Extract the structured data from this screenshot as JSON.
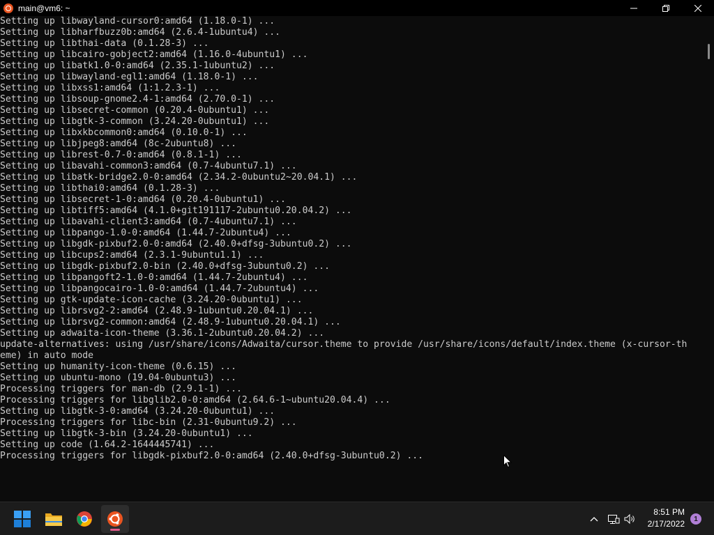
{
  "window": {
    "title": "main@vm6: ~"
  },
  "terminal": {
    "lines": [
      "Setting up libwayland-cursor0:amd64 (1.18.0-1) ...",
      "Setting up libharfbuzz0b:amd64 (2.6.4-1ubuntu4) ...",
      "Setting up libthai-data (0.1.28-3) ...",
      "Setting up libcairo-gobject2:amd64 (1.16.0-4ubuntu1) ...",
      "Setting up libatk1.0-0:amd64 (2.35.1-1ubuntu2) ...",
      "Setting up libwayland-egl1:amd64 (1.18.0-1) ...",
      "Setting up libxss1:amd64 (1:1.2.3-1) ...",
      "Setting up libsoup-gnome2.4-1:amd64 (2.70.0-1) ...",
      "Setting up libsecret-common (0.20.4-0ubuntu1) ...",
      "Setting up libgtk-3-common (3.24.20-0ubuntu1) ...",
      "Setting up libxkbcommon0:amd64 (0.10.0-1) ...",
      "Setting up libjpeg8:amd64 (8c-2ubuntu8) ...",
      "Setting up librest-0.7-0:amd64 (0.8.1-1) ...",
      "Setting up libavahi-common3:amd64 (0.7-4ubuntu7.1) ...",
      "Setting up libatk-bridge2.0-0:amd64 (2.34.2-0ubuntu2~20.04.1) ...",
      "Setting up libthai0:amd64 (0.1.28-3) ...",
      "Setting up libsecret-1-0:amd64 (0.20.4-0ubuntu1) ...",
      "Setting up libtiff5:amd64 (4.1.0+git191117-2ubuntu0.20.04.2) ...",
      "Setting up libavahi-client3:amd64 (0.7-4ubuntu7.1) ...",
      "Setting up libpango-1.0-0:amd64 (1.44.7-2ubuntu4) ...",
      "Setting up libgdk-pixbuf2.0-0:amd64 (2.40.0+dfsg-3ubuntu0.2) ...",
      "Setting up libcups2:amd64 (2.3.1-9ubuntu1.1) ...",
      "Setting up libgdk-pixbuf2.0-bin (2.40.0+dfsg-3ubuntu0.2) ...",
      "Setting up libpangoft2-1.0-0:amd64 (1.44.7-2ubuntu4) ...",
      "Setting up libpangocairo-1.0-0:amd64 (1.44.7-2ubuntu4) ...",
      "Setting up gtk-update-icon-cache (3.24.20-0ubuntu1) ...",
      "Setting up librsvg2-2:amd64 (2.48.9-1ubuntu0.20.04.1) ...",
      "Setting up librsvg2-common:amd64 (2.48.9-1ubuntu0.20.04.1) ...",
      "Setting up adwaita-icon-theme (3.36.1-2ubuntu0.20.04.2) ...",
      "update-alternatives: using /usr/share/icons/Adwaita/cursor.theme to provide /usr/share/icons/default/index.theme (x-cursor-th",
      "eme) in auto mode",
      "Setting up humanity-icon-theme (0.6.15) ...",
      "Setting up ubuntu-mono (19.04-0ubuntu3) ...",
      "Processing triggers for man-db (2.9.1-1) ...",
      "Processing triggers for libglib2.0-0:amd64 (2.64.6-1~ubuntu20.04.4) ...",
      "Setting up libgtk-3-0:amd64 (3.24.20-0ubuntu1) ...",
      "Processing triggers for libc-bin (2.31-0ubuntu9.2) ...",
      "Setting up libgtk-3-bin (3.24.20-0ubuntu1) ...",
      "Setting up code (1.64.2-1644445741) ...",
      "Processing triggers for libgdk-pixbuf2.0-0:amd64 (2.40.0+dfsg-3ubuntu0.2) ..."
    ]
  },
  "taskbar": {
    "apps": [
      {
        "name": "start",
        "icon": "windows-start-icon"
      },
      {
        "name": "file-explorer",
        "icon": "folder-icon"
      },
      {
        "name": "chrome",
        "icon": "chrome-icon"
      },
      {
        "name": "ubuntu-terminal",
        "icon": "ubuntu-icon",
        "active": true
      }
    ],
    "clock": {
      "time": "8:51 PM",
      "date": "2/17/2022"
    },
    "notification_count": "1"
  },
  "colors": {
    "terminal_bg": "#0c0c0c",
    "terminal_fg": "#cccccc",
    "ubuntu_orange": "#e95420",
    "taskbar_bg": "#1c1c1c"
  }
}
